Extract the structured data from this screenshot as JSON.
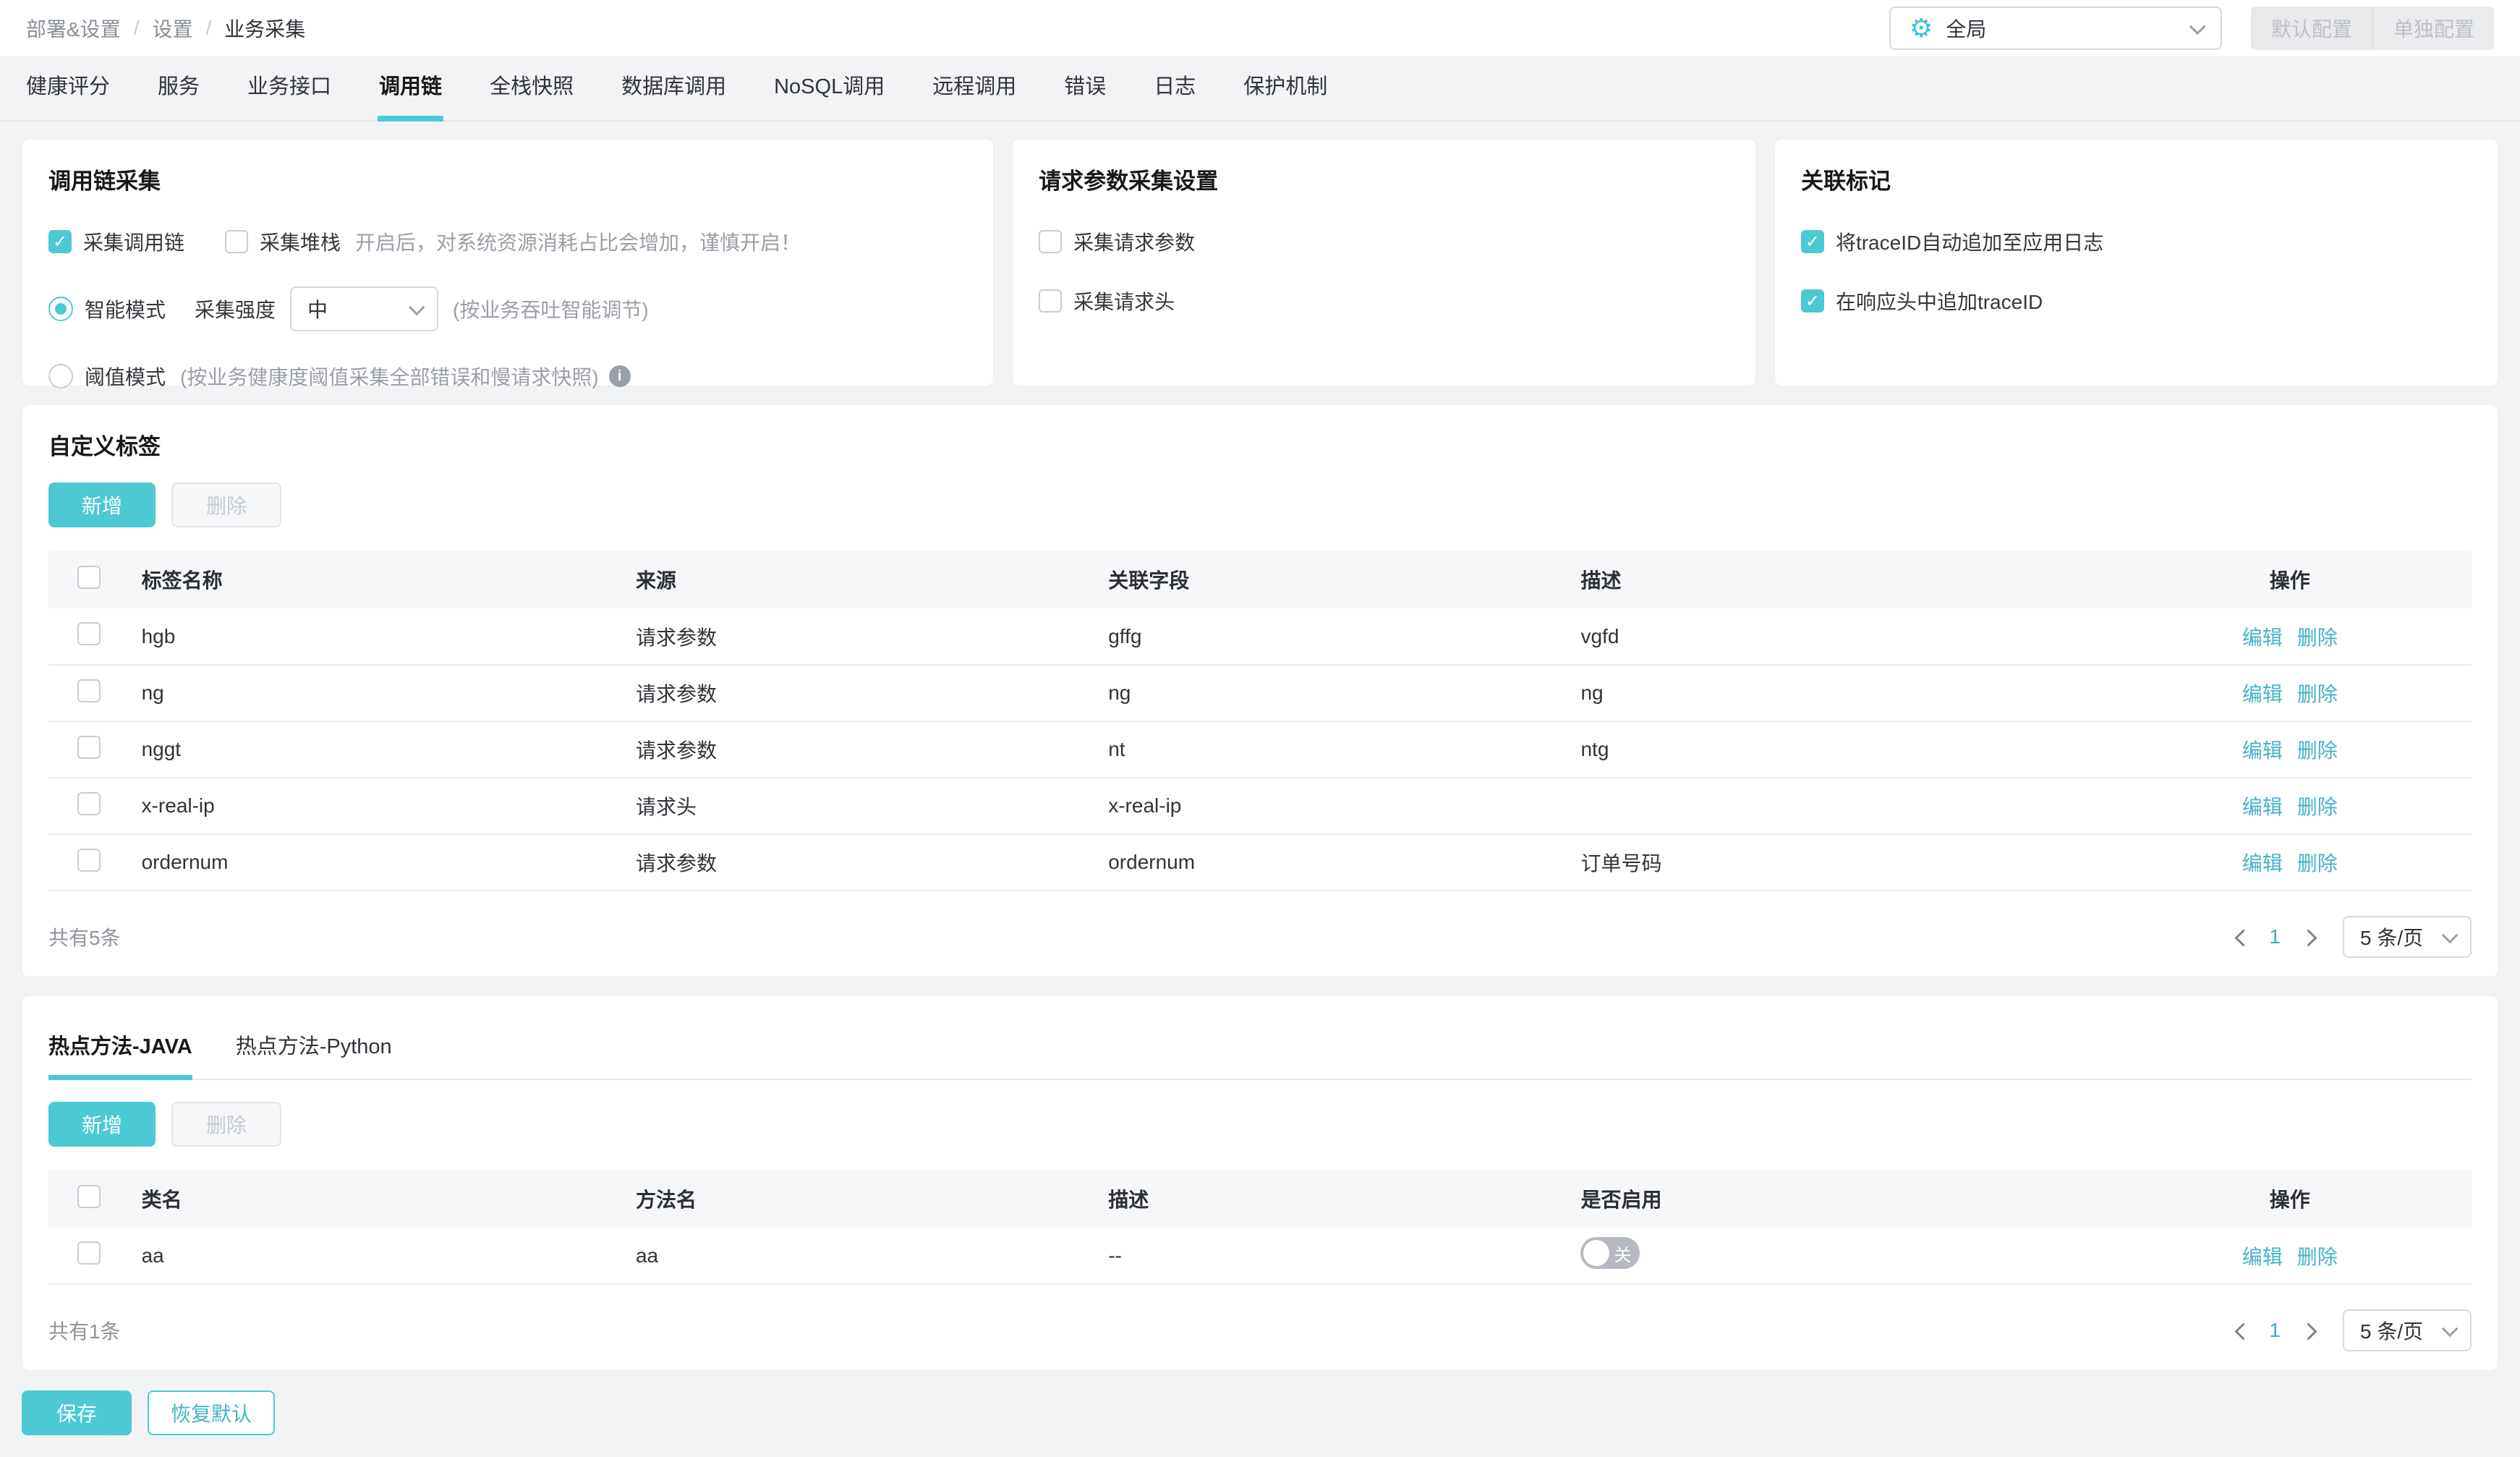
{
  "header": {
    "breadcrumb": [
      "部署&设置",
      "设置",
      "业务采集"
    ],
    "scope_select": {
      "value": "全局",
      "icon": "gear-icon"
    },
    "default_config_label": "默认配置",
    "separate_config_label": "单独配置"
  },
  "tabs": {
    "items": [
      "健康评分",
      "服务",
      "业务接口",
      "调用链",
      "全栈快照",
      "数据库调用",
      "NoSQL调用",
      "远程调用",
      "错误",
      "日志",
      "保护机制"
    ],
    "active": "调用链"
  },
  "cards": {
    "trace_collect": {
      "title": "调用链采集",
      "collect_trace": {
        "label": "采集调用链",
        "checked": true
      },
      "collect_stack": {
        "label": "采集堆栈",
        "checked": false,
        "hint": "开启后，对系统资源消耗占比会增加，谨慎开启！"
      },
      "smart_mode": {
        "label": "智能模式",
        "selected": true,
        "strength_label": "采集强度",
        "strength_value": "中",
        "hint": "(按业务吞吐智能调节)"
      },
      "threshold_mode": {
        "label": "阈值模式",
        "selected": false,
        "hint": "(按业务健康度阈值采集全部错误和慢请求快照)"
      }
    },
    "request_params": {
      "title": "请求参数采集设置",
      "collect_params": {
        "label": "采集请求参数",
        "checked": false
      },
      "collect_headers": {
        "label": "采集请求头",
        "checked": false
      }
    },
    "relation_mark": {
      "title": "关联标记",
      "trace_to_log": {
        "label": "将traceID自动追加至应用日志",
        "checked": true
      },
      "trace_in_header": {
        "label": "在响应头中追加traceID",
        "checked": true
      }
    }
  },
  "custom_tags": {
    "title": "自定义标签",
    "add_label": "新增",
    "delete_label": "删除",
    "columns": [
      "标签名称",
      "来源",
      "关联字段",
      "描述",
      "操作"
    ],
    "rows": [
      {
        "name": "hgb",
        "source": "请求参数",
        "field": "gffg",
        "desc": "vgfd"
      },
      {
        "name": "ng",
        "source": "请求参数",
        "field": "ng",
        "desc": "ng"
      },
      {
        "name": "nggt",
        "source": "请求参数",
        "field": "nt",
        "desc": "ntg"
      },
      {
        "name": "x-real-ip",
        "source": "请求头",
        "field": "x-real-ip",
        "desc": ""
      },
      {
        "name": "ordernum",
        "source": "请求参数",
        "field": "ordernum",
        "desc": "订单号码"
      }
    ],
    "edit_label": "编辑",
    "remove_label": "删除",
    "total_text": "共有5条",
    "page": "1",
    "page_size": "5 条/页"
  },
  "hot_methods": {
    "tabs": [
      "热点方法-JAVA",
      "热点方法-Python"
    ],
    "active": "热点方法-JAVA",
    "add_label": "新增",
    "delete_label": "删除",
    "columns": [
      "类名",
      "方法名",
      "描述",
      "是否启用",
      "操作"
    ],
    "rows": [
      {
        "class_name": "aa",
        "method": "aa",
        "desc": "--",
        "enabled": false,
        "toggle_label": "关"
      }
    ],
    "edit_label": "编辑",
    "remove_label": "删除",
    "total_text": "共有1条",
    "page": "1",
    "page_size": "5 条/页"
  },
  "footer": {
    "save_label": "保存",
    "reset_label": "恢复默认"
  },
  "colors": {
    "accent": "#4cc9d3",
    "link": "#45b3c9",
    "toggle_off": "#b6b9bf"
  }
}
